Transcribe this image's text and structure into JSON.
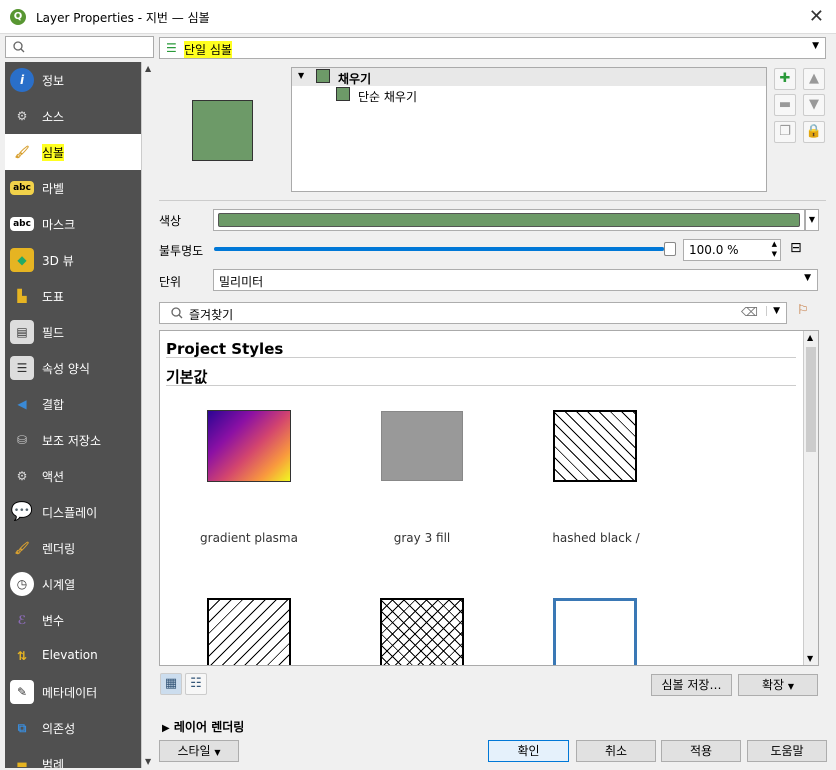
{
  "window": {
    "title": "Layer Properties - 지번 — 심볼"
  },
  "sidebar": {
    "search_placeholder": "",
    "items": [
      {
        "label": "정보",
        "icon": "info-icon"
      },
      {
        "label": "소스",
        "icon": "source-icon"
      },
      {
        "label": "심볼",
        "icon": "symbology-icon"
      },
      {
        "label": "라벨",
        "icon": "labels-icon"
      },
      {
        "label": "마스크",
        "icon": "masks-icon"
      },
      {
        "label": "3D 뷰",
        "icon": "3d-view-icon"
      },
      {
        "label": "도표",
        "icon": "diagrams-icon"
      },
      {
        "label": "필드",
        "icon": "fields-icon"
      },
      {
        "label": "속성 양식",
        "icon": "attributes-form-icon"
      },
      {
        "label": "결합",
        "icon": "joins-icon"
      },
      {
        "label": "보조 저장소",
        "icon": "auxiliary-storage-icon"
      },
      {
        "label": "액션",
        "icon": "actions-icon"
      },
      {
        "label": "디스플레이",
        "icon": "display-icon"
      },
      {
        "label": "렌더링",
        "icon": "rendering-icon"
      },
      {
        "label": "시계열",
        "icon": "temporal-icon"
      },
      {
        "label": "변수",
        "icon": "variables-icon"
      },
      {
        "label": "Elevation",
        "icon": "elevation-icon"
      },
      {
        "label": "메타데이터",
        "icon": "metadata-icon"
      },
      {
        "label": "의존성",
        "icon": "dependencies-icon"
      },
      {
        "label": "범례",
        "icon": "legend-icon"
      }
    ]
  },
  "renderer": {
    "value": "단일 심볼"
  },
  "symbol_tree": {
    "root": "채우기",
    "child": "단순 채우기"
  },
  "color": {
    "label": "색상",
    "value": "#6d9a68"
  },
  "opacity": {
    "label": "불투명도",
    "value": "100.0 %",
    "fraction": 1.0
  },
  "unit": {
    "label": "단위",
    "value": "밀리미터"
  },
  "style_search": {
    "value": "즐겨찾기"
  },
  "styles": {
    "project_heading": "Project Styles",
    "default_heading": "기본값",
    "items": [
      {
        "label": "gradient  plasma"
      },
      {
        "label": "gray 3 fill"
      },
      {
        "label": "hashed black /"
      },
      {
        "label": ""
      },
      {
        "label": ""
      },
      {
        "label": ""
      }
    ]
  },
  "buttons": {
    "save_symbol": "심볼 저장…",
    "advanced": "확장",
    "layer_rendering": "레이어 렌더링",
    "style": "스타일",
    "ok": "확인",
    "cancel": "취소",
    "apply": "적용",
    "help": "도움말"
  }
}
